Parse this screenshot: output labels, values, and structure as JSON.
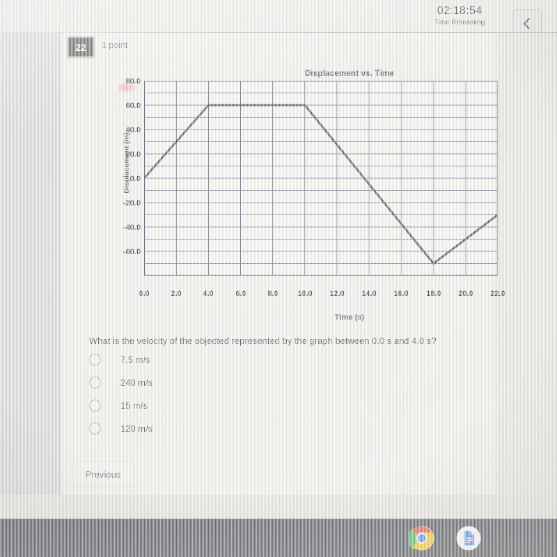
{
  "header": {
    "timer": "02:18:54",
    "timer_label": "Time Remaining",
    "back_icon": "chevron-left-icon"
  },
  "question_meta": {
    "number": "22",
    "points": "1 point"
  },
  "chart_data": {
    "type": "line",
    "title": "Displacement vs. Time",
    "xlabel": "Time (s)",
    "ylabel": "Displacement (m)",
    "xlim": [
      0,
      22
    ],
    "ylim": [
      -80,
      80
    ],
    "xticks": [
      "0.0",
      "2.0",
      "4.0",
      "6.0",
      "8.0",
      "10.0",
      "12.0",
      "14.0",
      "16.0",
      "18.0",
      "20.0",
      "22.0"
    ],
    "yticks": [
      "80.0",
      "60.0",
      "40.0",
      "20.0",
      "0.0",
      "-20.0",
      "-40.0",
      "-60.0"
    ],
    "grid": true,
    "legend": "none",
    "series": [
      {
        "name": "Displacement",
        "x": [
          0,
          4,
          10,
          18,
          22
        ],
        "y": [
          0,
          60,
          60,
          -70,
          -30
        ]
      }
    ]
  },
  "question": {
    "text": "What is the velocity of the objected represented by the graph between 0.0 s and 4.0 s?",
    "options": [
      {
        "label": "7.5 m/s",
        "selected": false
      },
      {
        "label": "240 m/s",
        "selected": false
      },
      {
        "label": "15 m/s",
        "selected": false
      },
      {
        "label": "120 m/s",
        "selected": false
      }
    ]
  },
  "footer": {
    "previous_label": "Previous"
  },
  "taskbar": {
    "icons": [
      "chrome-icon",
      "google-docs-icon"
    ]
  },
  "colors": {
    "badge_bg": "#50504f",
    "plot_line": "#4a4a58",
    "grid": "#6f6f86",
    "taskbar_bg": "#4a4c52"
  }
}
